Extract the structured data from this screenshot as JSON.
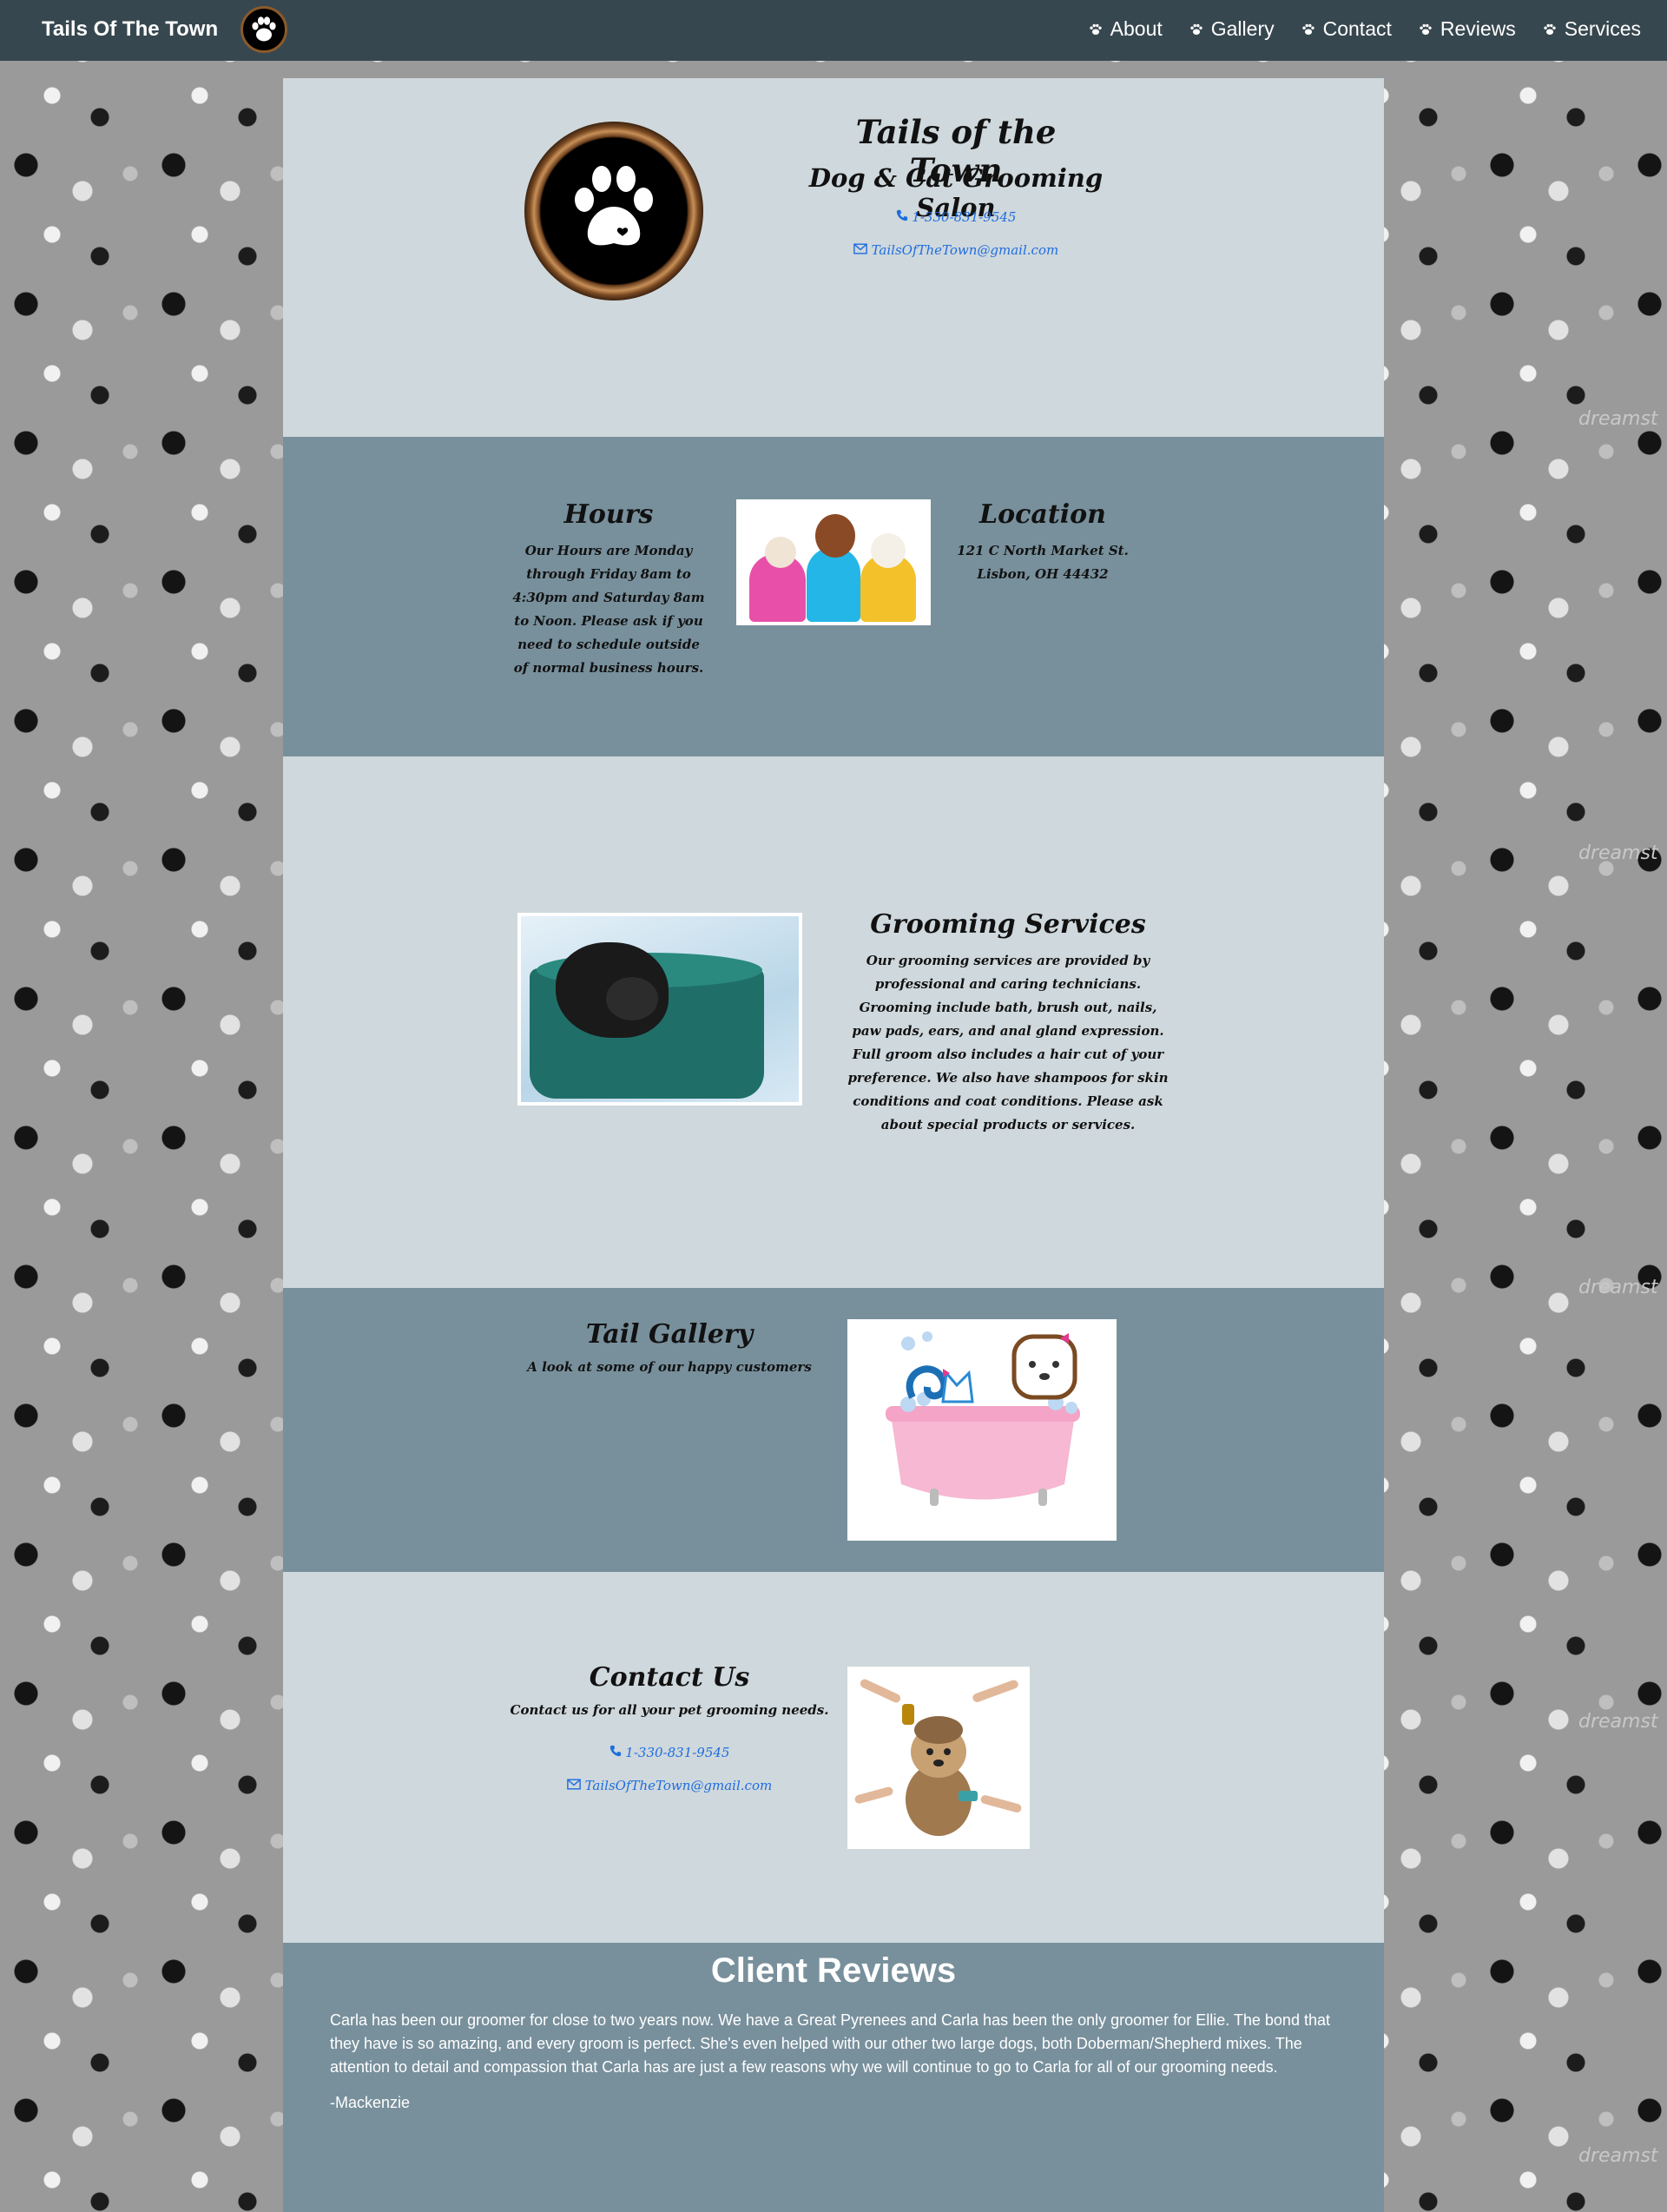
{
  "nav": {
    "brand": "Tails Of The Town",
    "items": [
      "About",
      "Gallery",
      "Contact",
      "Reviews",
      "Services"
    ]
  },
  "header": {
    "title": "Tails of the Town",
    "subtitle": "Dog & Cat Grooming Salon",
    "phone": "1-330-831-9545",
    "email": "TailsOfTheTown@gmail.com"
  },
  "hours": {
    "title": "Hours",
    "text": "Our Hours are Monday through Friday 8am to 4:30pm and Saturday 8am to Noon. Please ask if you need to schedule outside of normal business hours."
  },
  "location": {
    "title": "Location",
    "text": "121 C North Market St. Lisbon, OH 44432"
  },
  "services": {
    "title": "Grooming Services",
    "text": "Our grooming services are provided by professional and caring technicians. Grooming include bath, brush out, nails, paw pads, ears, and anal gland expression. Full groom also includes a hair cut of your preference. We also have shampoos for skin conditions and coat conditions. Please ask about special products or services."
  },
  "gallery": {
    "title": "Tail Gallery",
    "text": "A look at some of our happy customers"
  },
  "contact": {
    "title": "Contact Us",
    "text": "Contact us for all your pet grooming needs.",
    "phone": "1-330-831-9545",
    "email": "TailsOfTheTown@gmail.com"
  },
  "reviews": {
    "title": "Client Reviews",
    "text": "Carla has been our groomer for close to two years now. We have a Great Pyrenees and Carla has been the only groomer for Ellie. The bond that they have is so amazing, and every groom is perfect. She's even helped with our other two large dogs, both Doberman/Shepherd mixes. The attention to detail and compassion that Carla has are just a few reasons why we will continue to go to Carla for all of our grooming needs.",
    "author": "-Mackenzie"
  },
  "watermark": "dreamst",
  "colors": {
    "navbar": "#37474f",
    "light_section": "#cfd8dc",
    "dark_section": "#78909c",
    "link": "#1e6de0"
  },
  "icons": [
    "paw-icon",
    "phone-icon",
    "envelope-icon"
  ]
}
